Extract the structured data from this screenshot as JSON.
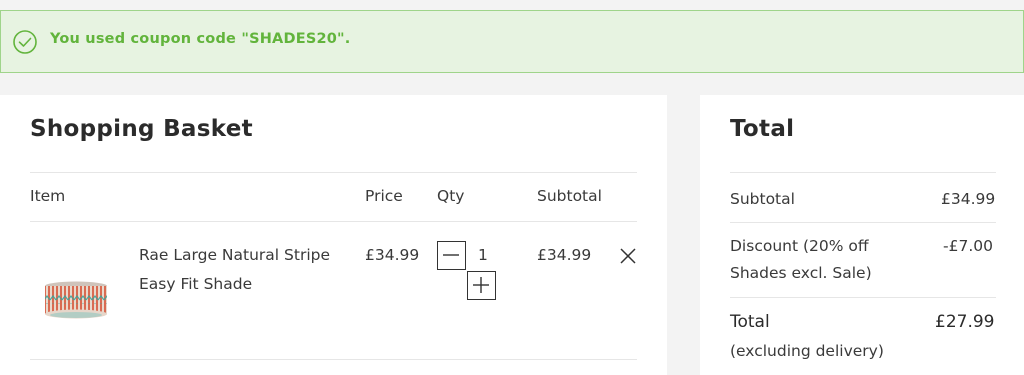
{
  "notice": {
    "message": "You used coupon code \"SHADES20\".",
    "icon": "check-circle-icon",
    "color": "#62b43c",
    "background": "#e7f3e1"
  },
  "basket": {
    "title": "Shopping Basket",
    "columns": {
      "item": "Item",
      "price": "Price",
      "qty": "Qty",
      "subtotal": "Subtotal"
    },
    "items": [
      {
        "name_line1": "Rae Large Natural Stripe",
        "name_line2": "Easy Fit Shade",
        "price": "£34.99",
        "qty": "1",
        "subtotal": "£34.99",
        "image": "lampshade-thumbnail"
      }
    ]
  },
  "totals": {
    "title": "Total",
    "subtotal_label": "Subtotal",
    "subtotal_value": "£34.99",
    "discount_label_line1": "Discount (20% off",
    "discount_label_line2": "Shades excl. Sale)",
    "discount_value": "-£7.00",
    "total_label": "Total",
    "total_value": "£27.99",
    "total_note": "(excluding delivery)"
  }
}
